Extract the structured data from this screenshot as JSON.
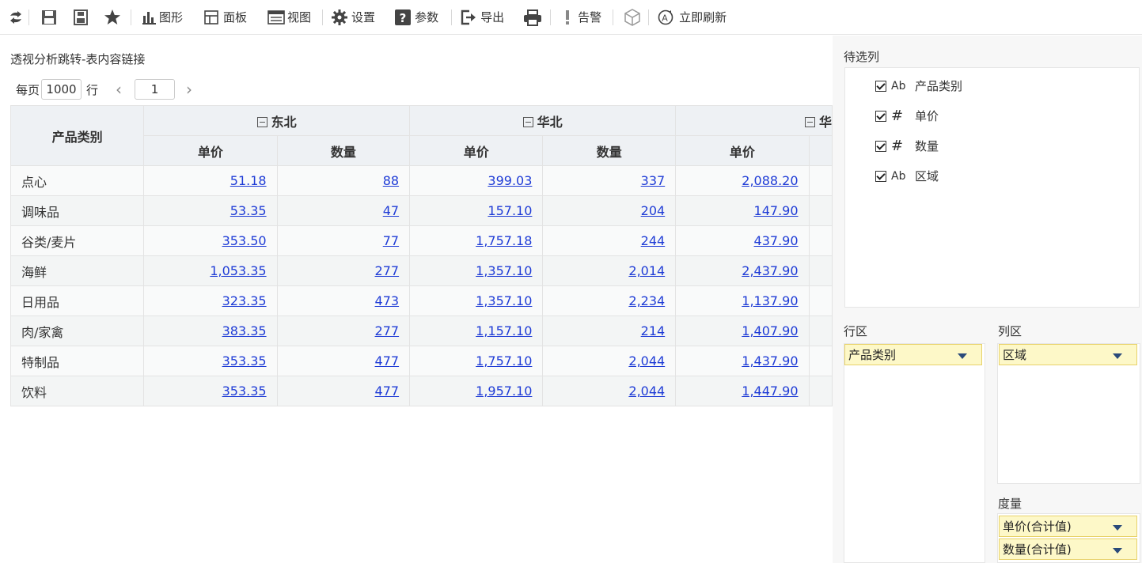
{
  "toolbar": {
    "graph": "图形",
    "panel": "面板",
    "view": "视图",
    "settings": "设置",
    "params": "参数",
    "export": "导出",
    "alert": "告警",
    "refresh": "立即刷新"
  },
  "report": {
    "title": "透视分析跳转-表内容链接",
    "pager": {
      "prefix": "每页",
      "size": "1000",
      "suffix": "行",
      "page": "1"
    }
  },
  "grid": {
    "row_header": "产品类别",
    "groups": [
      "东北",
      "华北",
      "华"
    ],
    "measures": [
      "单价",
      "数量",
      "单价",
      "数量",
      "单价"
    ],
    "rows": [
      {
        "label": "点心",
        "values": [
          "51.18",
          "88",
          "399.03",
          "337",
          "2,088.20"
        ]
      },
      {
        "label": "调味品",
        "values": [
          "53.35",
          "47",
          "157.10",
          "204",
          "147.90"
        ]
      },
      {
        "label": "谷类/麦片",
        "values": [
          "353.50",
          "77",
          "1,757.18",
          "244",
          "437.90"
        ]
      },
      {
        "label": "海鲜",
        "values": [
          "1,053.35",
          "277",
          "1,357.10",
          "2,014",
          "2,437.90"
        ]
      },
      {
        "label": "日用品",
        "values": [
          "323.35",
          "473",
          "1,357.10",
          "2,234",
          "1,137.90"
        ]
      },
      {
        "label": "肉/家禽",
        "values": [
          "383.35",
          "277",
          "1,157.10",
          "214",
          "1,407.90"
        ]
      },
      {
        "label": "特制品",
        "values": [
          "353.35",
          "477",
          "1,757.10",
          "2,044",
          "1,437.90"
        ]
      },
      {
        "label": "饮料",
        "values": [
          "353.35",
          "477",
          "1,957.10",
          "2,044",
          "1,447.90"
        ]
      }
    ]
  },
  "side": {
    "candidates_title": "待选列",
    "fields": [
      {
        "type": "Ab",
        "name": "产品类别"
      },
      {
        "type": "#",
        "name": "单价"
      },
      {
        "type": "#",
        "name": "数量"
      },
      {
        "type": "Ab",
        "name": "区域"
      }
    ],
    "row_zone_title": "行区",
    "col_zone_title": "列区",
    "row_field": "产品类别",
    "col_field": "区域",
    "measure_title": "度量",
    "measures": [
      "单价(合计值)",
      "数量(合计值)"
    ]
  }
}
